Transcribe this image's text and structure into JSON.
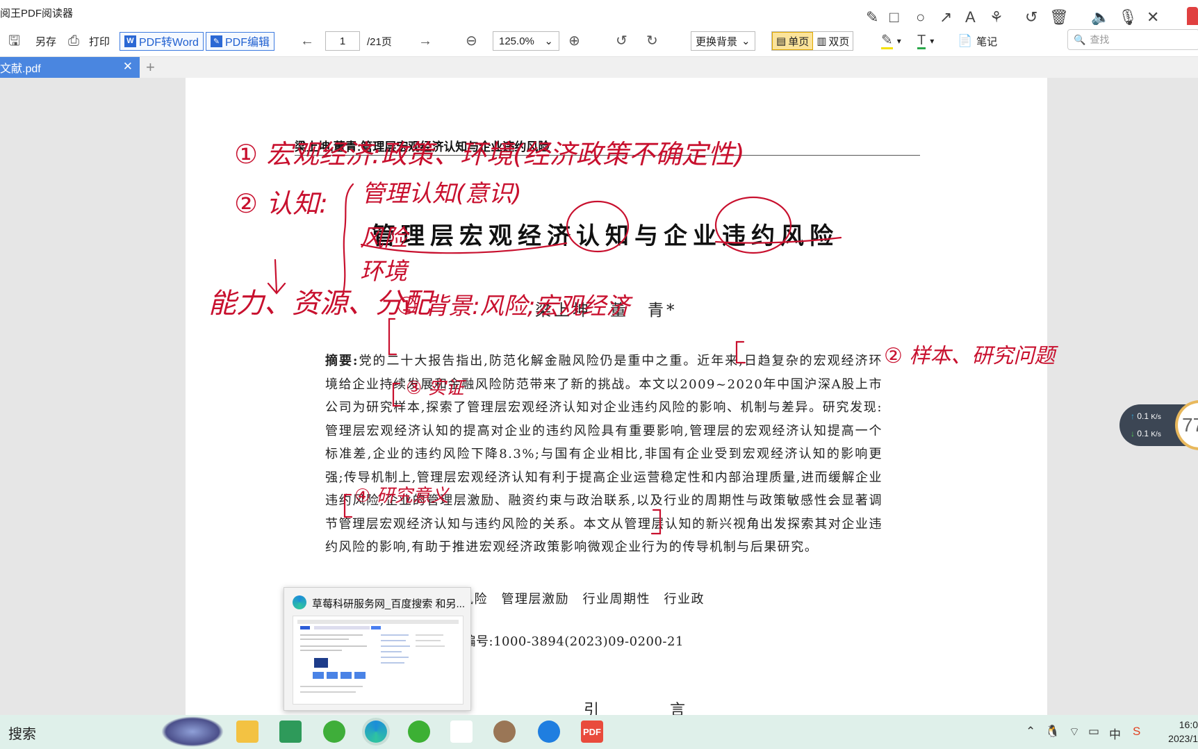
{
  "app": {
    "title": "阅王PDF阅读器"
  },
  "toolbar": {
    "save_as": "另存",
    "print": "打印",
    "pdf_to_word": "PDF转Word",
    "pdf_edit": "PDF编辑",
    "page_current": "1",
    "page_total": "/21页",
    "zoom": "125.0%",
    "background": "更换背景",
    "single_page": "单页",
    "double_page": "双页",
    "notes": "笔记",
    "search_placeholder": "查找"
  },
  "tab": {
    "label": "文献.pdf"
  },
  "document": {
    "running_head": "梁上坤,董青:管理层宏观经济认知与企业违约风险",
    "title": "管理层宏观经济认知与企业违约风险",
    "authors": "梁上坤　董　青*",
    "abstract_label": "摘要:",
    "abstract_text": "党的二十大报告指出,防范化解金融风险仍是重中之重。近年来,日趋复杂的宏观经济环境给企业持续发展和金融风险防范带来了新的挑战。本文以2009~2020年中国沪深A股上市公司为研究样本,探索了管理层宏观经济认知对企业违约风险的影响、机制与差异。研究发现:管理层宏观经济认知的提高对企业的违约风险具有重要影响,管理层的宏观经济认知提高一个标准差,企业的违约风险下降8.3%;与国有企业相比,非国有企业受到宏观经济认知的影响更强;传导机制上,管理层宏观经济认知有利于提高企业运营稳定性和内部治理质量,进而缓解企业违约风险;企业的管理层激励、融资约束与政治联系,以及行业的周期性与政策敏感性会显著调节管理层宏观经济认知与违约风险的关系。本文从管理层认知的新兴视角出发探索其对企业违约风险的影响,有助于推进宏观经济政策影响微观企业行为的传导机制与后果研究。",
    "keywords": "观经济认知　企业违约风险　管理层激励　行业周期性　行业政",
    "classification": "5　文献标识码:A　文章编号:1000-3894(2023)09-0200-21",
    "intro_heading": "引　言"
  },
  "handwriting": {
    "line1": "① 宏观经济:政策、环境(经济政策不确定性)",
    "line2": "② 认知:",
    "line2_items": [
      "管理认知(意识)",
      "风险",
      "环境"
    ],
    "line3": "能力、资源、分配",
    "note_bg": "① 背景:风险;宏观经济",
    "note_sample": "② 样本、研究问题",
    "note_empirical": "③ 实证",
    "note_meaning": "④ 研究意义",
    "ink_color": "#c8102e"
  },
  "network": {
    "up": "0.1",
    "down": "0.1",
    "unit": "K/s",
    "gauge": "77"
  },
  "preview": {
    "title": "草莓科研服务网_百度搜索 和另..."
  },
  "taskbar": {
    "search": "搜索",
    "ime": "中",
    "time": "16:0",
    "date": "2023/1"
  }
}
